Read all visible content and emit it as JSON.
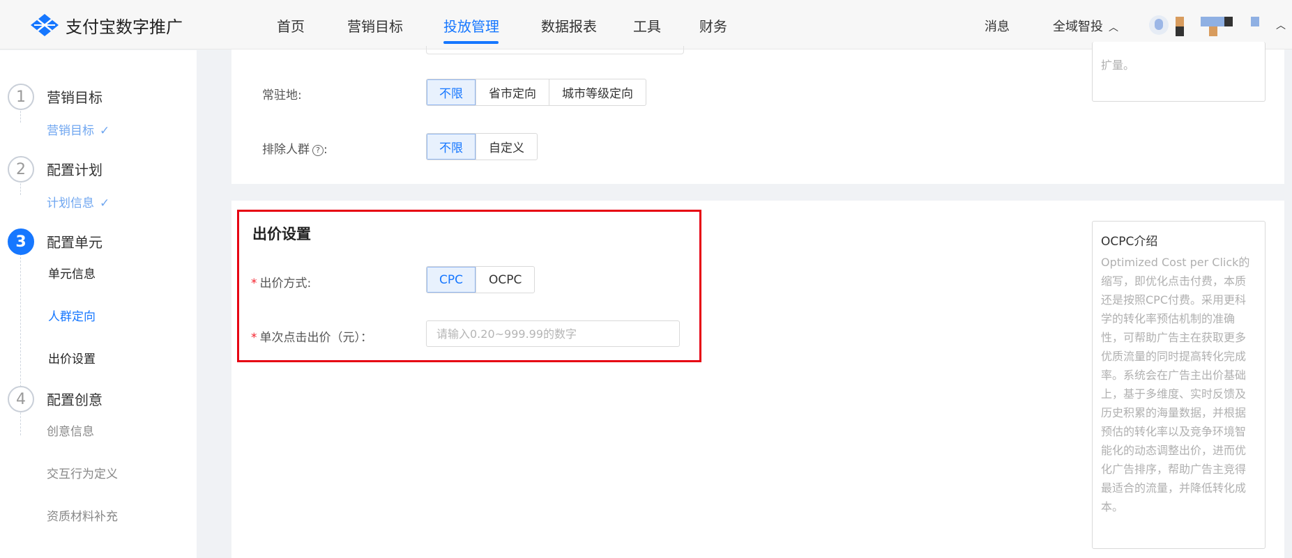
{
  "brand": {
    "name": "支付宝数字推广"
  },
  "nav": {
    "items": [
      {
        "label": "首页"
      },
      {
        "label": "营销目标"
      },
      {
        "label": "投放管理"
      },
      {
        "label": "数据报表"
      },
      {
        "label": "工具"
      },
      {
        "label": "财务"
      }
    ],
    "active_index": 2
  },
  "header_right": {
    "messages": "消息",
    "product_switch": "全域智投"
  },
  "colors": {
    "accent": "#1677ff",
    "highlight": "#e60012"
  },
  "steps": [
    {
      "num": "1",
      "title": "营销目标",
      "subs": [
        {
          "label": "营销目标",
          "state": "done"
        }
      ]
    },
    {
      "num": "2",
      "title": "配置计划",
      "subs": [
        {
          "label": "计划信息",
          "state": "done"
        }
      ]
    },
    {
      "num": "3",
      "title": "配置单元",
      "subs": [
        {
          "label": "单元信息"
        },
        {
          "label": "人群定向"
        },
        {
          "label": "出价设置"
        }
      ]
    },
    {
      "num": "4",
      "title": "配置创意",
      "subs": [
        {
          "label": "创意信息"
        },
        {
          "label": "交互行为定义"
        },
        {
          "label": "资质材料补充"
        }
      ]
    }
  ],
  "targeting": {
    "residence": {
      "label": "常驻地:",
      "options": [
        "不限",
        "省市定向",
        "城市等级定向"
      ],
      "selected": "不限"
    },
    "exclude": {
      "label": "排除人群",
      "suffix": ":",
      "options": [
        "不限",
        "自定义"
      ],
      "selected": "不限"
    },
    "prev_tip_tail": "扩量。"
  },
  "bidding": {
    "title": "出价设置",
    "method": {
      "label": "出价方式:",
      "options": [
        "CPC",
        "OCPC"
      ],
      "selected": "CPC"
    },
    "price": {
      "label": "单次点击出价（元）：",
      "placeholder": "请输入0.20~999.99的数字",
      "value": ""
    }
  },
  "info": {
    "title": "OCPC介绍",
    "body": "Optimized Cost per Click的缩写，即优化点击付费，本质还是按照CPC付费。采用更科学的转化率预估机制的准确性，可帮助广告主在获取更多优质流量的同时提高转化完成率。系统会在广告主出价基础上，基于多维度、实时反馈及历史积累的海量数据，并根据预估的转化率以及竞争环境智能化的动态调整出价，进而优化广告排序，帮助广告主竞得最适合的流量，并降低转化成本。"
  }
}
